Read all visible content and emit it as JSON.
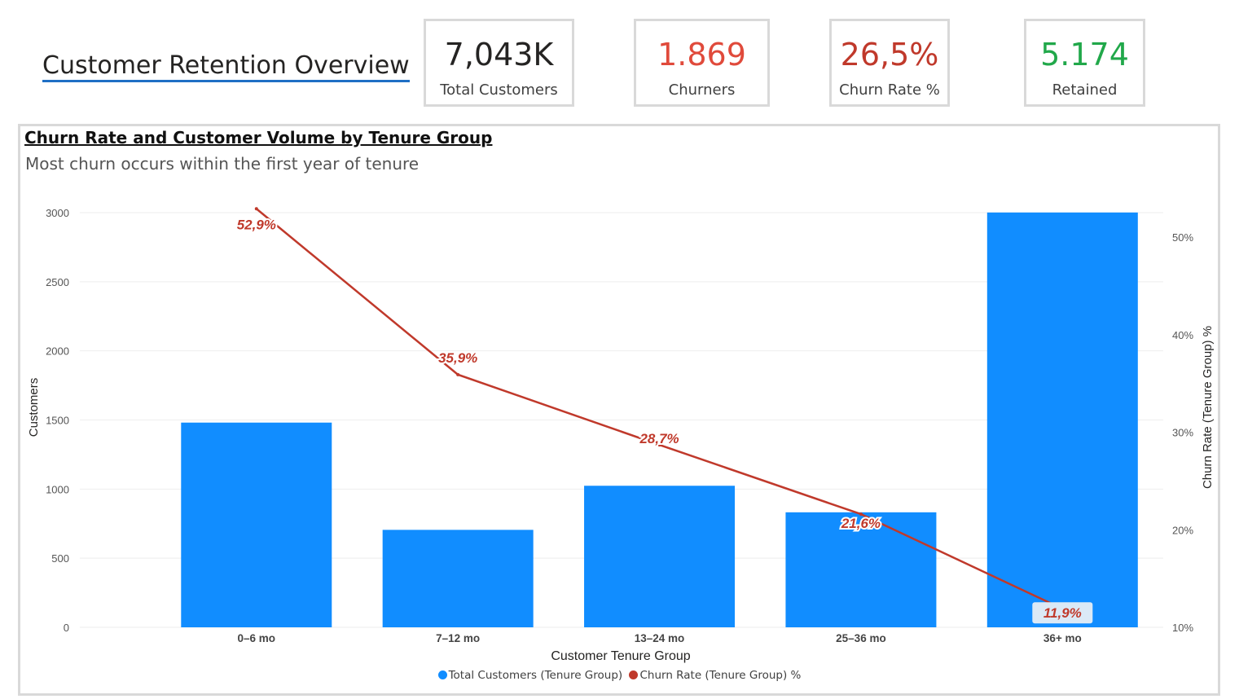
{
  "page": {
    "title": "Customer Retention Overview"
  },
  "kpis": [
    {
      "value": "7,043K",
      "label": "Total Customers",
      "color": "#252423"
    },
    {
      "value": "1.869",
      "label": "Churners",
      "color": "#e04a3b"
    },
    {
      "value": "26,5%",
      "label": "Churn Rate %",
      "color": "#c0392b"
    },
    {
      "value": "5.174",
      "label": "Retained",
      "color": "#21a84a"
    }
  ],
  "chart": {
    "title": "Churn Rate and Customer Volume by Tenure Group",
    "subtitle": "Most churn occurs within the first year of tenure"
  },
  "legend": {
    "bars_label": "Total Customers (Tenure Group)",
    "line_label": "Churn Rate (Tenure Group) %"
  },
  "chart_data": {
    "type": "bar+line",
    "title": "Churn Rate and Customer Volume by Tenure Group",
    "subtitle": "Most churn occurs within the first year of tenure",
    "xlabel": "Customer Tenure Group",
    "ylabel": "Customers",
    "y2label": "Churn Rate (Tenure Group) %",
    "categories": [
      "0–6 mo",
      "7–12 mo",
      "13–24 mo",
      "25–36 mo",
      "36+ mo"
    ],
    "series": [
      {
        "name": "Total Customers (Tenure Group)",
        "type": "bar",
        "axis": "left",
        "color": "#118dff",
        "values": [
          1481,
          705,
          1024,
          832,
          3001
        ]
      },
      {
        "name": "Churn Rate (Tenure Group) %",
        "type": "line",
        "axis": "right",
        "color": "#c0392b",
        "values": [
          52.9,
          35.9,
          28.7,
          21.6,
          11.9
        ],
        "labels": [
          "52,9%",
          "35,9%",
          "28,7%",
          "21,6%",
          "11,9%"
        ]
      }
    ],
    "ylim": [
      0,
      3000
    ],
    "y_ticks": [
      0,
      500,
      1000,
      1500,
      2000,
      2500,
      3000
    ],
    "y2lim": [
      10,
      50
    ],
    "y2_ticks": [
      10,
      20,
      30,
      40,
      50
    ],
    "y2_tick_labels": [
      "10%",
      "20%",
      "30%",
      "40%",
      "50%"
    ],
    "grid": true,
    "legend_position": "bottom-center"
  }
}
